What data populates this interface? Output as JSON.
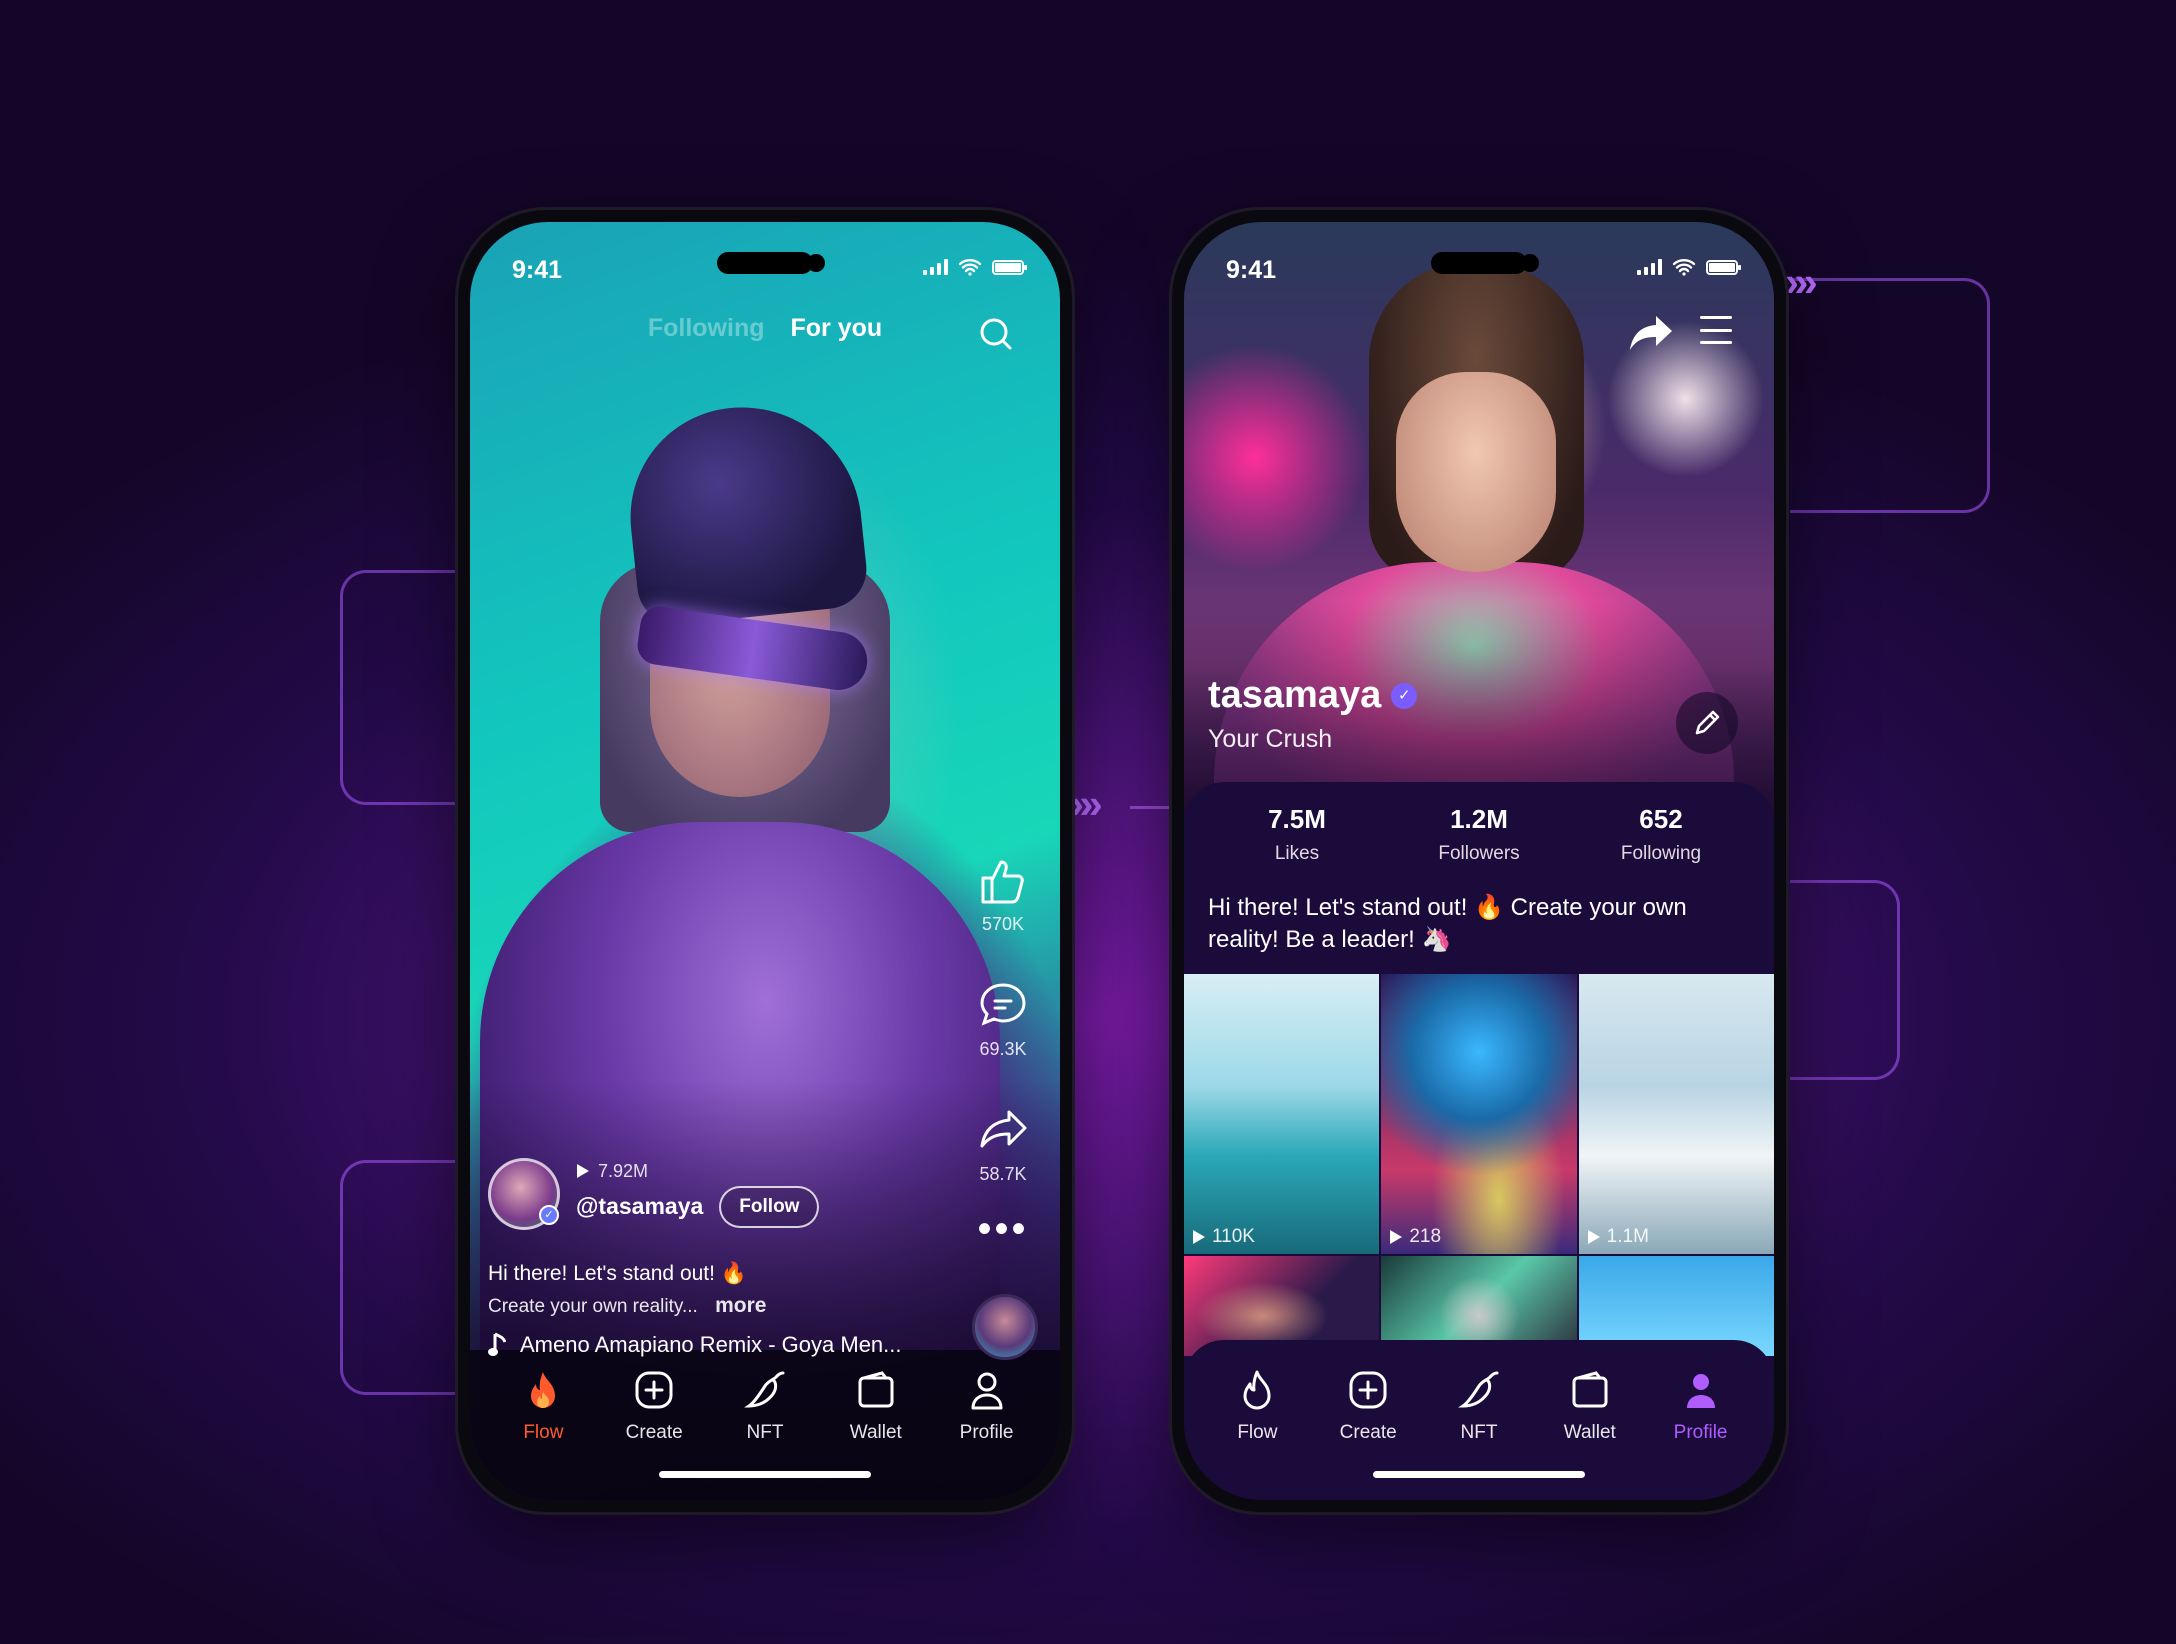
{
  "colors": {
    "background": "#1a0834",
    "accent_orange": "#ff5a2e",
    "accent_purple": "#b05cff",
    "panel": "#1b0b3a",
    "verified": "#7a5cff"
  },
  "left_phone": {
    "status_time": "9:41",
    "tabs": {
      "following": "Following",
      "for_you": "For you"
    },
    "search_icon": "search-icon",
    "actions": {
      "likes": "570K",
      "comments": "69.3K",
      "shares": "58.7K"
    },
    "creator": {
      "views": "7.92M",
      "handle": "@tasamaya",
      "follow_label": "Follow"
    },
    "caption_line1": "Hi there! Let's stand out! 🔥",
    "caption_line2": "Create your own reality...",
    "more_label": "more",
    "music_title": "Ameno Amapiano Remix - Goya Men...",
    "tabbar": [
      {
        "label": "Flow",
        "icon": "flame-icon",
        "active": true
      },
      {
        "label": "Create",
        "icon": "plus-square-icon",
        "active": false
      },
      {
        "label": "NFT",
        "icon": "pepper-icon",
        "active": false
      },
      {
        "label": "Wallet",
        "icon": "wallet-icon",
        "active": false
      },
      {
        "label": "Profile",
        "icon": "user-icon",
        "active": false
      }
    ]
  },
  "right_phone": {
    "status_time": "9:41",
    "profile": {
      "name": "tasamaya",
      "subtitle": "Your Crush",
      "stats": [
        {
          "value": "7.5M",
          "label": "Likes"
        },
        {
          "value": "1.2M",
          "label": "Followers"
        },
        {
          "value": "652",
          "label": "Following"
        }
      ],
      "bio": "Hi there! Let's stand out! 🔥 Create your own reality! Be a leader! 🦄"
    },
    "grid": [
      {
        "count": "110K"
      },
      {
        "count": "218"
      },
      {
        "count": "1.1M"
      }
    ],
    "tabbar": [
      {
        "label": "Flow",
        "icon": "flame-icon",
        "active": false
      },
      {
        "label": "Create",
        "icon": "plus-square-icon",
        "active": false
      },
      {
        "label": "NFT",
        "icon": "pepper-icon",
        "active": false
      },
      {
        "label": "Wallet",
        "icon": "wallet-icon",
        "active": false
      },
      {
        "label": "Profile",
        "icon": "user-icon",
        "active": true
      }
    ]
  }
}
